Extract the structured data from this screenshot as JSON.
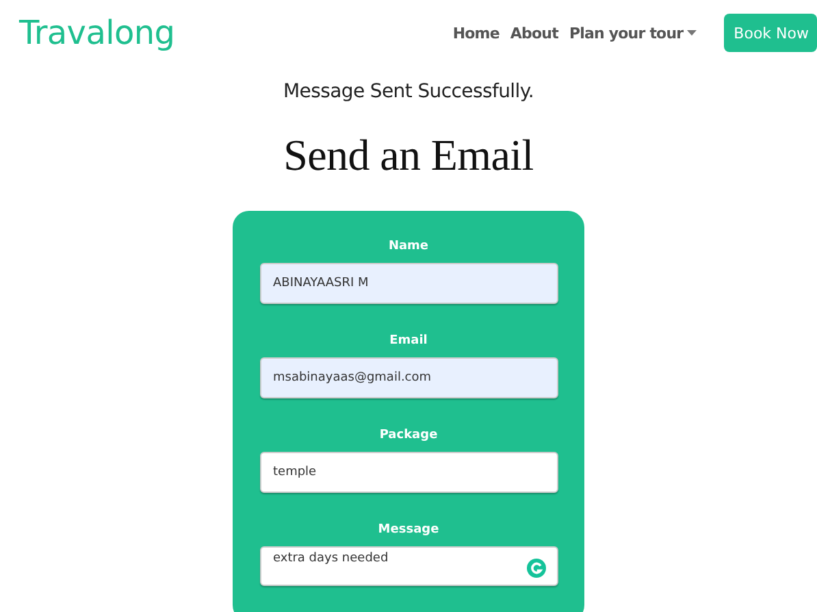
{
  "navbar": {
    "brand": "Travalong",
    "links": [
      {
        "label": "Home",
        "kind": "link"
      },
      {
        "label": "About",
        "kind": "link"
      },
      {
        "label": "Plan your tour",
        "kind": "dropdown"
      }
    ],
    "cta": "Book Now"
  },
  "status_message": "Message Sent Successfully.",
  "heading": "Send an Email",
  "form": {
    "fields": [
      {
        "label": "Name",
        "value": "ABINAYAASRI M",
        "kind": "input",
        "autofilled": true
      },
      {
        "label": "Email",
        "value": "msabinayaas@gmail.com",
        "kind": "input",
        "autofilled": true
      },
      {
        "label": "Package",
        "value": "temple",
        "kind": "input",
        "autofilled": false
      },
      {
        "label": "Message",
        "value": "extra days needed",
        "kind": "textarea",
        "autofilled": false
      }
    ]
  }
}
